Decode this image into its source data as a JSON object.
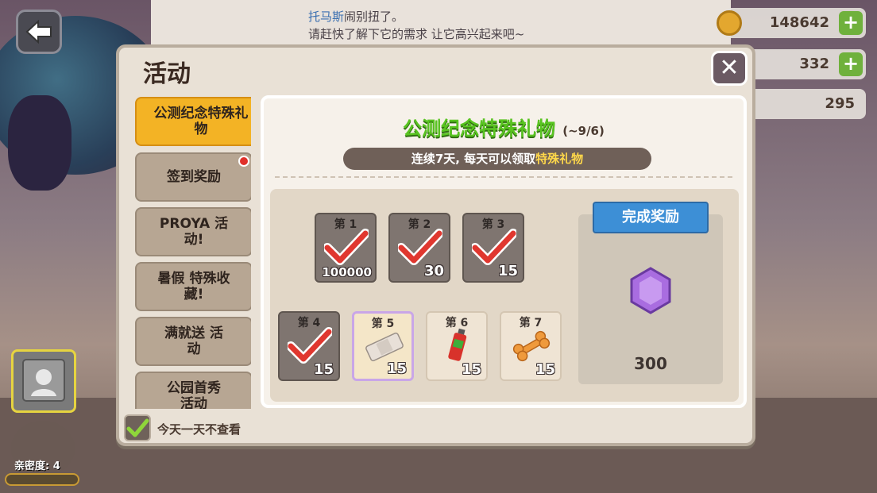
{
  "notice": {
    "pet_name": "托马斯",
    "line1_rest": "闹别扭了。",
    "line2": "请赶快了解下它的需求  让它高兴起来吧~"
  },
  "resources": [
    {
      "icon": "coin-icon",
      "value": "148642",
      "color": "#e3a72f"
    },
    {
      "icon": "gem-icon",
      "value": "332",
      "color": "#9a6fd0"
    },
    {
      "icon": "heart-icon",
      "value": "295",
      "color": "#e2506a"
    }
  ],
  "dialog": {
    "title": "活动",
    "close_label": "✕",
    "tabs": [
      {
        "label": "公测纪念特殊礼物",
        "active": true
      },
      {
        "label": "签到奖励",
        "badge": true
      },
      {
        "label": "PROYA 活动!"
      },
      {
        "label": "暑假 特殊收藏!"
      },
      {
        "label": "满就送 活动"
      },
      {
        "label": "公园首秀 活动"
      }
    ],
    "panel": {
      "title": "公测纪念特殊礼物",
      "date_range": "(~9/6)",
      "desc_prefix": "连续7天, 每天可以领取",
      "desc_highlight": "特殊礼物",
      "days": [
        {
          "label": "第 1",
          "qty": "100000",
          "state": "done"
        },
        {
          "label": "第 2",
          "qty": "30",
          "state": "done"
        },
        {
          "label": "第 3",
          "qty": "15",
          "state": "done"
        },
        {
          "label": "第 4",
          "qty": "15",
          "state": "done"
        },
        {
          "label": "第 5",
          "qty": "15",
          "state": "today"
        },
        {
          "label": "第 6",
          "qty": "15",
          "state": "todo"
        },
        {
          "label": "第 7",
          "qty": "15",
          "state": "todo"
        }
      ],
      "reward_title": "完成奖励",
      "reward_value": "300"
    },
    "footer_label": "今天一天不查看"
  },
  "pet": {
    "intimacy_label": "亲密度: 4"
  }
}
